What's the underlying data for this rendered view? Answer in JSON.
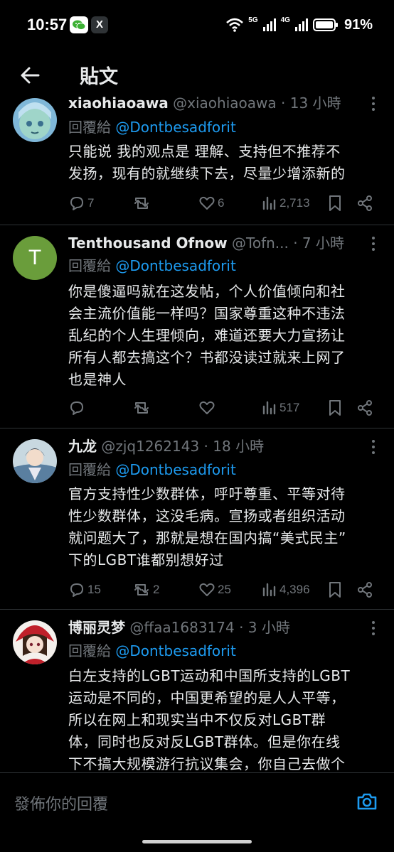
{
  "status_bar": {
    "time": "10:57",
    "network_1": "5G",
    "network_2": "4G",
    "battery": "91%"
  },
  "header": {
    "title": "貼文",
    "back_icon": "arrow-left-icon"
  },
  "tweets": [
    {
      "name": "xiaohiaoawa",
      "handle": "@xiaohiaoawa",
      "time": "· 13 小時",
      "reply_prefix": "回覆給",
      "reply_to": "@Dontbesadforit",
      "lines": [
        "只能说 我的观点是 理解、支持但不推荐不",
        "发扬，现有的就继续下去，尽量少增添新的"
      ],
      "replies": "7",
      "retweets": "",
      "likes": "6",
      "views": "2,713"
    },
    {
      "name": "Tenthousand Ofnow",
      "handle": "@Tofn...",
      "time": "· 7 小時",
      "avatar_letter": "T",
      "reply_prefix": "回覆給",
      "reply_to": "@Dontbesadforit",
      "lines": [
        "你是傻逼吗就在这发帖，个人价值倾向和社",
        "会主流价值能一样吗？国家尊重这种不违法",
        "乱纪的个人生理倾向，难道还要大力宣扬让",
        "所有人都去搞这个？书都没读过就来上网了",
        "也是神人"
      ],
      "replies": "",
      "retweets": "",
      "likes": "",
      "views": "517"
    },
    {
      "name": "九龙",
      "handle": "@zjq1262143",
      "time": "· 18 小時",
      "reply_prefix": "回覆給",
      "reply_to": "@Dontbesadforit",
      "lines": [
        "官方支持性少数群体，呼吁尊重、平等对待",
        "性少数群体，这没毛病。宣扬或者组织活动",
        "就问题大了，那就是想在国内搞“美式民主”",
        "下的LGBT谁都别想好过"
      ],
      "replies": "15",
      "retweets": "2",
      "likes": "25",
      "views": "4,396"
    },
    {
      "name": "博丽灵梦",
      "handle": "@ffaa1683174",
      "time": "· 3 小時",
      "reply_prefix": "回覆給",
      "reply_to": "@Dontbesadforit",
      "lines": [
        "白左支持的LGBT运动和中国所支持的LGBT",
        "运动是不同的，中国更希望的是人人平等，",
        "所以在网上和现实当中不仅反对LGBT群",
        "体，同时也反对反LGBT群体。但是你在线",
        "下不搞大规模游行抗议集会，你自己去做个"
      ]
    }
  ],
  "reply_box": {
    "placeholder": "發佈你的回覆"
  },
  "colors": {
    "background": "#000000",
    "text": "#e7e9ea",
    "muted": "#71767b",
    "accent": "#1d9bf0",
    "divider": "#2f3336",
    "avatar_green": "#6a9d3b"
  }
}
